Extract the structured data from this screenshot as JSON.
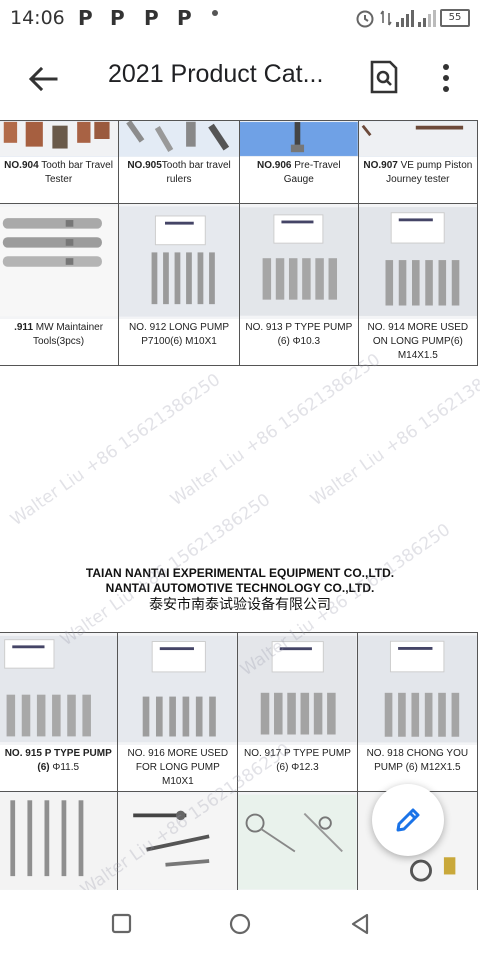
{
  "status_bar": {
    "time": "14:06",
    "notification_icons": [
      "P",
      "P",
      "P",
      "P"
    ],
    "battery": "55"
  },
  "app_bar": {
    "title": "2021 Product Cat..."
  },
  "rows": [
    [
      {
        "num": "NO.904",
        "text": " Tooth bar Travel Tester"
      },
      {
        "num": "NO.905",
        "text": "Tooth bar travel rulers"
      },
      {
        "num": "NO.906",
        "text": " Pre-Travel Gauge"
      },
      {
        "num": "NO.907",
        "text": " VE pump Piston Journey tester"
      }
    ],
    [
      {
        "num": ".911",
        "text": " MW Maintainer Tools(3pcs)"
      },
      {
        "num": "",
        "text": "NO. 912 LONG PUMP P7100(6) M10X1"
      },
      {
        "num": "",
        "text": "NO. 913 P TYPE PUMP (6) Φ10.3"
      },
      {
        "num": "",
        "text": "NO. 914 MORE USED ON LONG PUMP(6) M14X1.5"
      }
    ],
    [
      {
        "num": "NO. 915 P TYPE PUMP (6)",
        "text": " Φ11.5"
      },
      {
        "num": "",
        "text": "NO. 916 MORE USED FOR LONG PUMP M10X1"
      },
      {
        "num": "",
        "text": "NO. 917 P TYPE PUMP (6) Φ12.3"
      },
      {
        "num": "",
        "text": "NO. 918 CHONG YOU PUMP (6) M12X1.5"
      }
    ]
  ],
  "company": {
    "line1": "TAIAN NANTAI EXPERIMENTAL EQUIPMENT CO.,LTD.",
    "line2": "NANTAI AUTOMOTIVE TECHNOLOGY CO.,LTD.",
    "line3": "泰安市南泰试验设备有限公司"
  },
  "watermark_text": "Walter Liu +86 15621386250",
  "icons": {
    "back": "arrow-back-icon",
    "search_document": "search-document-icon",
    "more": "more-vert-icon",
    "edit": "pencil-edit-icon",
    "nav": [
      "square-recents-icon",
      "circle-home-icon",
      "triangle-back-icon"
    ]
  },
  "colors": {
    "fab_icon": "#1a73e8",
    "text": "#202124"
  }
}
